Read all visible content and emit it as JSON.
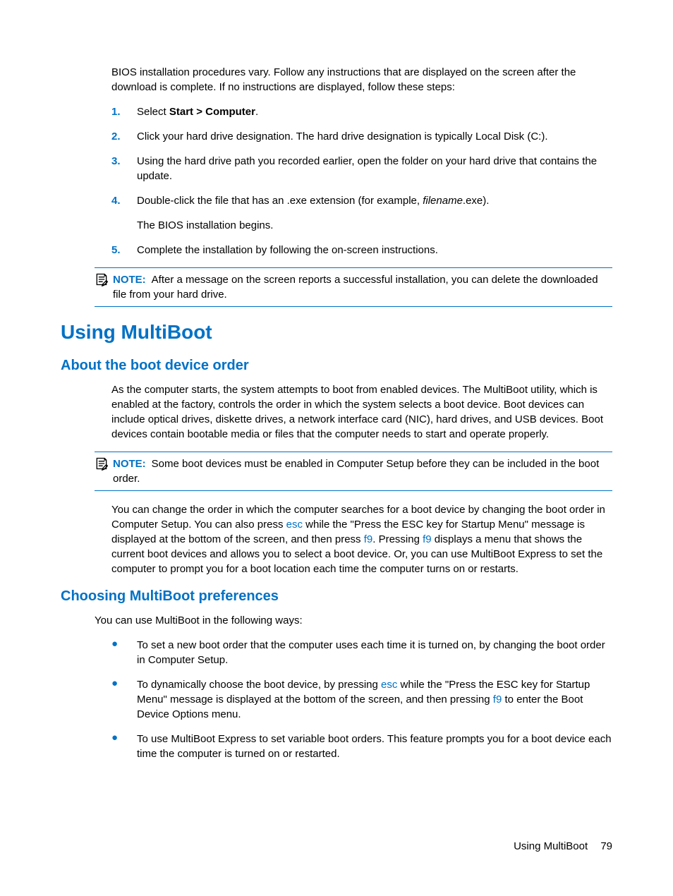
{
  "intro": "BIOS installation procedures vary. Follow any instructions that are displayed on the screen after the download is complete. If no instructions are displayed, follow these steps:",
  "steps": {
    "s1_num": "1.",
    "s1_pre": "Select ",
    "s1_bold": "Start > Computer",
    "s1_post": ".",
    "s2_num": "2.",
    "s2": "Click your hard drive designation. The hard drive designation is typically Local Disk (C:).",
    "s3_num": "3.",
    "s3": "Using the hard drive path you recorded earlier, open the folder on your hard drive that contains the update.",
    "s4_num": "4.",
    "s4_pre": "Double-click the file that has an .exe extension (for example, ",
    "s4_italic": "filename",
    "s4_post": ".exe).",
    "s4_sub": "The BIOS installation begins.",
    "s5_num": "5.",
    "s5": "Complete the installation by following the on-screen instructions."
  },
  "note1": {
    "label": "NOTE:",
    "text": "After a message on the screen reports a successful installation, you can delete the downloaded file from your hard drive."
  },
  "h1": "Using MultiBoot",
  "h2a": "About the boot device order",
  "para1": "As the computer starts, the system attempts to boot from enabled devices. The MultiBoot utility, which is enabled at the factory, controls the order in which the system selects a boot device. Boot devices can include optical drives, diskette drives, a network interface card (NIC), hard drives, and USB devices. Boot devices contain bootable media or files that the computer needs to start and operate properly.",
  "note2": {
    "label": "NOTE:",
    "text": "Some boot devices must be enabled in Computer Setup before they can be included in the boot order."
  },
  "para2": {
    "a": "You can change the order in which the computer searches for a boot device by changing the boot order in Computer Setup. You can also press ",
    "k1": "esc",
    "b": " while the \"Press the ESC key for Startup Menu\" message is displayed at the bottom of the screen, and then press ",
    "k2": "f9",
    "c": ". Pressing ",
    "k3": "f9",
    "d": " displays a menu that shows the current boot devices and allows you to select a boot device. Or, you can use MultiBoot Express to set the computer to prompt you for a boot location each time the computer turns on or restarts."
  },
  "h2b": "Choosing MultiBoot preferences",
  "para3": "You can use MultiBoot in the following ways:",
  "bullets": {
    "b1": "To set a new boot order that the computer uses each time it is turned on, by changing the boot order in Computer Setup.",
    "b2a": "To dynamically choose the boot device, by pressing ",
    "b2k1": "esc",
    "b2b": " while the \"Press the ESC key for Startup Menu\" message is displayed at the bottom of the screen, and then pressing ",
    "b2k2": "f9",
    "b2c": " to enter the Boot Device Options menu.",
    "b3": "To use MultiBoot Express to set variable boot orders. This feature prompts you for a boot device each time the computer is turned on or restarted."
  },
  "footer": {
    "section": "Using MultiBoot",
    "page": "79"
  }
}
